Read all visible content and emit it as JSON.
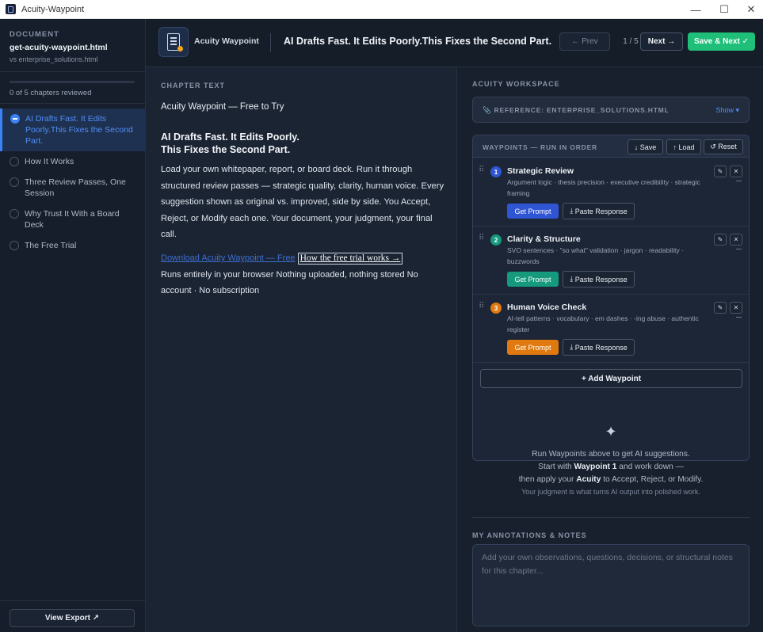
{
  "window": {
    "title": "Acuity-Waypoint",
    "minimize_glyph": "—",
    "maximize_glyph": "☐",
    "close_glyph": "✕"
  },
  "sidebar": {
    "section_label": "DOCUMENT",
    "doc_name": "get-acuity-waypoint.html",
    "doc_vs": "vs enterprise_solutions.html",
    "progress_fraction": 0,
    "progress_text": "0 of 5 chapters reviewed",
    "chapters": [
      {
        "label": "AI Drafts Fast. It Edits Poorly.This Fixes the Second Part.",
        "active": true
      },
      {
        "label": "How It Works",
        "active": false
      },
      {
        "label": "Three Review Passes, One Session",
        "active": false
      },
      {
        "label": "Why Trust It With a Board Deck",
        "active": false
      },
      {
        "label": "The Free Trial",
        "active": false
      }
    ],
    "view_export": "View Export ↗"
  },
  "header": {
    "brand": "Acuity Waypoint",
    "headline": "AI Drafts Fast. It Edits Poorly.This Fixes the Second Part.",
    "prev": "← Prev",
    "page": "1 / 5",
    "next": "Next →",
    "save_next": "Save & Next ✓"
  },
  "chapter": {
    "label": "CHAPTER TEXT",
    "subtitle": "Acuity Waypoint — Free to Try",
    "heading_line1": "AI Drafts Fast. It Edits Poorly.",
    "heading_line2": "This Fixes the Second Part.",
    "body": "Load your own whitepaper, report, or board deck. Run it through structured review passes — strategic quality, clarity, human voice. Every suggestion shown as original vs. improved, side by side. You Accept, Reject, or Modify each one. Your document, your judgment, your final call.",
    "download_link": "Download Acuity Waypoint — Free",
    "trial_link": "How the free trial works →",
    "footer": "Runs entirely in your browser Nothing uploaded, nothing stored No account · No subscription"
  },
  "workspace": {
    "label": "ACUITY WORKSPACE",
    "reference": "📎 REFERENCE: ENTERPRISE_SOLUTIONS.HTML",
    "show": "Show ▾",
    "waypoints_title": "WAYPOINTS — RUN IN ORDER",
    "save": "↓ Save",
    "load": "↑ Load",
    "reset": "↺ Reset",
    "get_prompt": "Get Prompt",
    "paste_response": "Paste Response",
    "waypoints": [
      {
        "num": "1",
        "name": "Strategic Review",
        "desc": "Argument logic · thesis precision · executive credibility · strategic framing",
        "color": "#2f55d4"
      },
      {
        "num": "2",
        "name": "Clarity & Structure",
        "desc": "SVO sentences · \"so what\" validation · jargon · readability · buzzwords",
        "color": "#159a7e"
      },
      {
        "num": "3",
        "name": "Human Voice Check",
        "desc": "AI-tell patterns · vocabulary · em dashes · -ing abuse · authentic register",
        "color": "#e07a10"
      }
    ],
    "add_waypoint": "+ Add Waypoint",
    "empty": {
      "sparkle": "✦",
      "line1": "Run Waypoints above to get AI suggestions.",
      "line2_a": "Start with",
      "line2_b": "Waypoint 1",
      "line2_c": "and work down —",
      "line3_a": "then apply your",
      "line3_b": "Acuity",
      "line3_c": "to Accept, Reject, or Modify.",
      "line4": "Your judgment is what turns AI output into polished work."
    },
    "notes_label": "MY ANNOTATIONS & NOTES",
    "notes_placeholder": "Add your own observations, questions, decisions, or structural notes for this chapter...",
    "notes_value": ""
  },
  "colors": {
    "accent": "#3b82f6",
    "save_next": "#1fbf7a"
  }
}
